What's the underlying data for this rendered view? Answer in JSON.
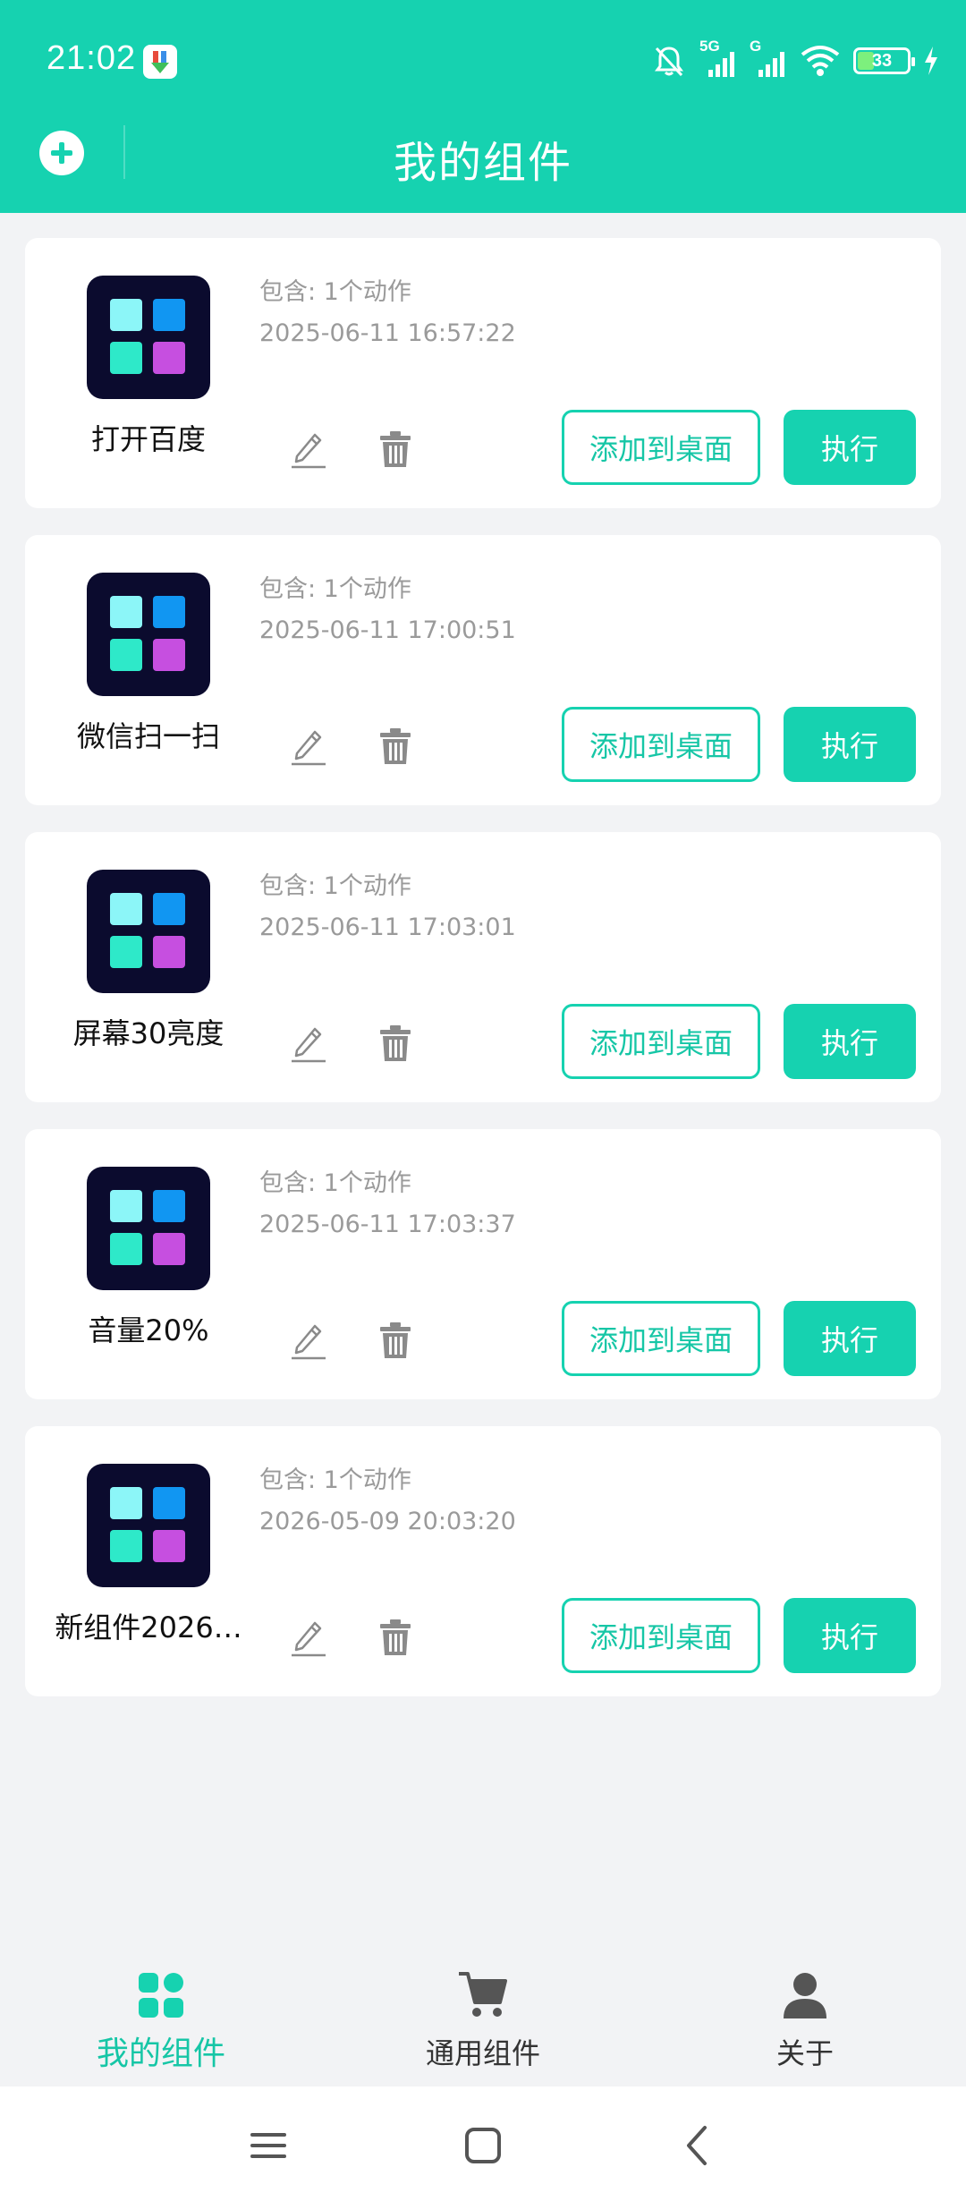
{
  "status_bar": {
    "time": "21:02",
    "network_5g": "5G",
    "network_g": "G",
    "battery": "33"
  },
  "header": {
    "title": "我的组件",
    "add_icon": "plus-circle-icon"
  },
  "widgets": [
    {
      "name": "打开百度",
      "contains": "包含: 1个动作",
      "timestamp": "2025-06-11 16:57:22"
    },
    {
      "name": "微信扫一扫",
      "contains": "包含: 1个动作",
      "timestamp": "2025-06-11 17:00:51"
    },
    {
      "name": "屏幕30亮度",
      "contains": "包含: 1个动作",
      "timestamp": "2025-06-11 17:03:01"
    },
    {
      "name": "音量20%",
      "contains": "包含: 1个动作",
      "timestamp": "2025-06-11 17:03:37"
    },
    {
      "name": "新组件2026…",
      "contains": "包含: 1个动作",
      "timestamp": "2026-05-09 20:03:20"
    }
  ],
  "card_actions": {
    "add_to_desktop": "添加到桌面",
    "execute": "执行"
  },
  "bottom_nav": {
    "items": [
      {
        "label": "我的组件",
        "icon": "grid-icon",
        "active": true
      },
      {
        "label": "通用组件",
        "icon": "cart-icon",
        "active": false
      },
      {
        "label": "关于",
        "icon": "person-icon",
        "active": false
      }
    ]
  },
  "colors": {
    "accent": "#16d2b0",
    "background": "#f2f3f5",
    "widget_icon_bg": "#0b0b2e"
  }
}
